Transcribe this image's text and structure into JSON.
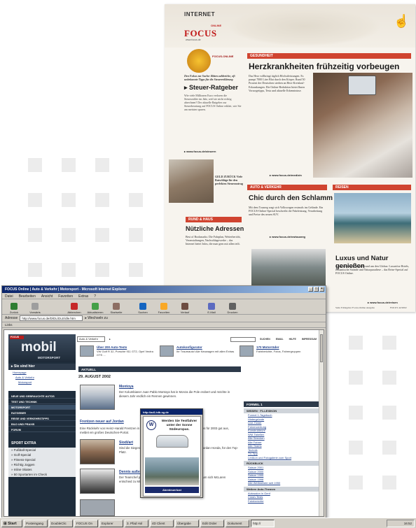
{
  "magazine": {
    "section": "INTERNET",
    "logo_online": "ONLINE",
    "logo_focus": "FOCUS",
    "logo_url": "www.focus.de",
    "badge_label": "FOCUS-ONLINE",
    "intro": "Den Fokus zur Sache: Bitten zahlreiche, oft unbekannte Tipps für die Steuererklärung",
    "left_title": "Steuer-Ratgeber",
    "left_text": "Wie viele Millionen Euro verloren die Steuerzahler im Jahr, weil sie nicht richtig abrechnen? Der aktuelle Ratgeber zur Steuerberatung auf FOCUS Online erklärt, wie Sie am meisten sparen.",
    "left_link": "www.focus.de/steuern",
    "photo_caption": "GELD ZURÜCK Viele Ratschläge für den perfekten Steuerantrag",
    "auto_bar": "RUND & HAUS",
    "nutzliche_title": "Nützliche Adressen",
    "nutzliche_text": "Best of Bookmarks: Die Fahrplan, Wetterbericht, Veranstaltungen, Nachschlagewerke – das Internet bietet Infos, die man gern mit allen teilt.",
    "gesundheit_bar": "GESUNDHEIT",
    "headline": "Herzkrankheiten frühzeitig vorbeugen",
    "main_text": "Das Herz vollbringt täglich Höchstleistungen. Es pumpt 7000 Liter Blut durch den Körper. Rund 50 Prozent der Deutschen sterben an Herz-Kreislauf-Erkrankungen. Die Online-Redaktion bietet Ihnen Vorsorgetipps, Tests und aktuelle Erkenntnisse.",
    "main_link": "www.focus.de/medizin",
    "auto_verkehr_bar": "AUTO & VERKEHR",
    "schlamm_title": "Chic durch den Schlamm",
    "schlamm_text": "Mit dem Touareg wagt sich Volkswagen erstmals ins Gelände. Ein FOCUS-Online-Special beschreibt die Fahrleistung, Verarbeitung und Preise des neuen SUV.",
    "schlamm_link": "www.focus.de/vwtouareg",
    "reisen_bar": "REISEN",
    "reisen_title": "Luxus und Natur genießen",
    "reisen_text": "Ausschweifender Besuch rund um den Globus: Luxuriöse Hotels, romantische Strände und Naturparadiese – das Reise-Special auf FOCUS Online.",
    "reisen_link": "www.focus.de/reisen",
    "footer_left": "Seite 8 Ratgeber Focus-Online Ausgabe",
    "footer_right": "FOCUS 42/2002"
  },
  "browser": {
    "title": "FOCUS Online | Auto & Verkehr | Motorsport - Microsoft Internet Explorer",
    "menu": [
      "Datei",
      "Bearbeiten",
      "Ansicht",
      "Favoriten",
      "Extras",
      "?"
    ],
    "toolbar": [
      "Zurück",
      "Vorwärts",
      "Abbrechen",
      "Aktualisieren",
      "Startseite",
      "Suchen",
      "Favoriten",
      "Verlauf",
      "E-Mail",
      "Drucken"
    ],
    "address_label": "Adresse",
    "address_value": "http://www.focus.de/D/DL/DLE/dle.htm",
    "go_label": "Wechseln zu",
    "links_label": "Links",
    "status_text": "Fertig",
    "status_zone": "Internet"
  },
  "site": {
    "logo_tag": "FOCUS",
    "logo_main": "mobil",
    "logo_sub": "MOTORSPORT",
    "nav_head": "Sie sind hier",
    "nav_path": [
      "Homepage",
      "Auto & Verkehr",
      "Motorsport"
    ],
    "nav_items": [
      "NEUE UND GEBRAUCHTE AUTOS",
      "TEST UND TECHNIK",
      "MOTORSPORT",
      "RATGEBER",
      "REISE UND VERKEHRSTIPPS",
      "BILD UND PRAXIS",
      "FORUM"
    ],
    "sport_head": "SPORT EXTRA",
    "sport_items": [
      "» Fußball-Special",
      "» Golf-Special",
      "» Fitness-Special",
      "» Richtig Joggen",
      "» Inline Skates",
      "» 50 Sportarten im Check"
    ],
    "select_value": "Auto & Verkehr",
    "search_label": "SUCHEN",
    "top_buttons": [
      "EMAIL",
      "HILFE",
      "IMPRESSUM"
    ],
    "promos": [
      {
        "title": "Über 200 Auto-Tests",
        "desc": "VW Golf R 32, Porsche 911 GT2, Opel Vectra GTS ..."
      },
      {
        "title": "Autokonfigurator",
        "desc": "Ihr Traumauto! Alle Neuwagen mit allen Extras"
      },
      {
        "title": "170 Motorräder",
        "desc": "Fahrberichte, Fotos, Fahrergruppen"
      }
    ],
    "aktuell": "AKTUELL",
    "date": "29. AUGUST 2002",
    "articles": [
      {
        "title": "Montoya",
        "text": "Der Kolumbianer Juan Pablo Montoya hat in Monza die Pole erobert und möchte in diesem Jahr endlich ein Rennen gewinnen."
      },
      {
        "title": "Frentzen neuer auf Jordan",
        "text": "Eine Rückkehr von Heinz-Harald Frentzen in die Formel 1 ist beschlossen, doch dafür sieht es für 2003 gut aus, meldet ein großes Deutschen-Portal."
      },
      {
        "title": "Siodi/art",
        "text": "Sind die Siegeschancen vorbei? Der Brite bleibt im Team von Jordan Honda, für den Top-Platz."
      },
      {
        "title": "Dennis außert Kritik an Bridgestone",
        "text": "Der Teamchef packt aus und spricht offen über die Gründe warum sich McLaren entschied zu Michelin zu wechseln."
      }
    ],
    "popup_title": "http://ad1.tdb.sg.de",
    "popup_text": "Werden Sie Testfahrer unter der Sonne Südeuropas.",
    "popup_button": "Abenteuerlust",
    "right_head": "FORMEL 1",
    "right_sub1": "WISSEN · F1-LEXIKON",
    "right_links1": [
      "Formel 1-Tagebuch",
      "Hintergründe",
      "Live-Ticker",
      "Fahrerwertung",
      "Konstrukteure",
      "WM-Tabellen",
      "Alle Strecken",
      "Alle Fahrer",
      "Alle Teams",
      "Technik",
      "TV-Tipp",
      "Lexikon und Fotogalerie zum Sport"
    ],
    "right_sub2": "RÜCKBLICK",
    "right_links2": [
      "Saison 2001",
      "Saison 2000",
      "Saison 1999",
      "Saison 1998",
      "Alle Weltmeister seit 1950"
    ],
    "right_sub3": "Weitere Auto-Themen",
    "right_links3": [
      "Autosalon in Genf",
      "Crash-Tests",
      "Fahrberichte"
    ]
  },
  "taskbar": {
    "start": "Start",
    "tasks": [
      "Posteingang",
      "DoubleClic",
      "FOCUS On",
      "Explorer",
      "3. Pfad Hol",
      "4D Client",
      "Übergabe",
      "Edit Order",
      "Dokument",
      "http://"
    ],
    "active_index": 9,
    "clock": "16:52"
  }
}
